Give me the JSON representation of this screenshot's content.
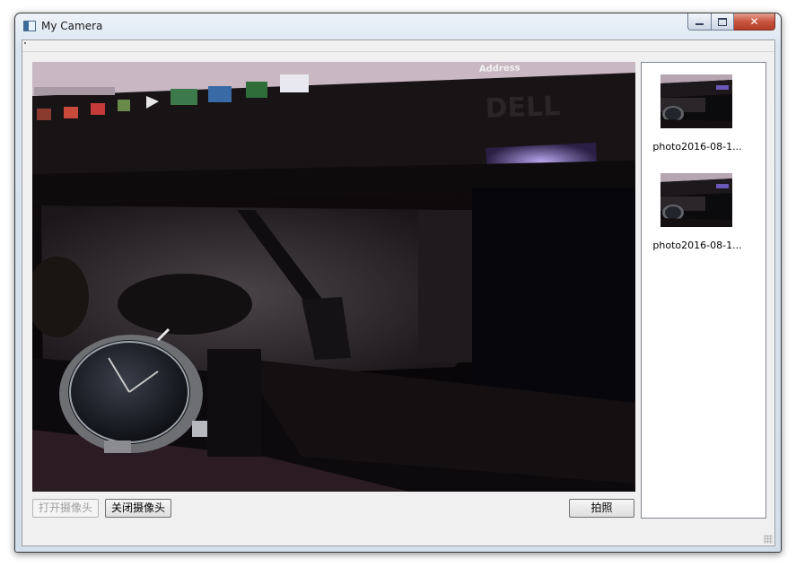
{
  "window": {
    "title": "My Camera",
    "icon": "app-window-icon",
    "controls": [
      "minimize-icon",
      "maximize-icon",
      "close-icon"
    ]
  },
  "camera": {
    "scene_text": {
      "brand": "DELL",
      "address": "Address"
    }
  },
  "buttons": {
    "open_camera": "打开摄像头",
    "close_camera": "关闭摄像头",
    "take_photo": "拍照"
  },
  "photos": [
    {
      "label": "photo2016-08-1..."
    },
    {
      "label": "photo2016-08-1..."
    }
  ]
}
